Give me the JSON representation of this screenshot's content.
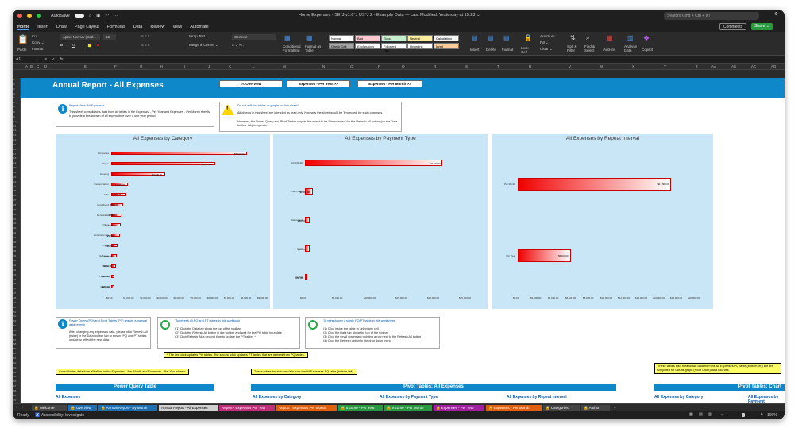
{
  "window": {
    "autosave": "AutoSave",
    "title": "Home Expenses - SE°J v1.0°J US°J 2 - Example Data — Last Modified: Yesterday at 15:23 ⌄",
    "search": "Search (Cmd + Ctrl + U)"
  },
  "menu": [
    "Home",
    "Insert",
    "Draw",
    "Page Layout",
    "Formulas",
    "Data",
    "Review",
    "View",
    "Automate"
  ],
  "menu_buttons": {
    "comments": "Comments",
    "share": "Share ⌄"
  },
  "ribbon": {
    "paste": "Paste",
    "cut": "Cut",
    "copy": "Copy ⌄",
    "format": "Format",
    "font": "Aptos Narrow (Bod...",
    "size": "12",
    "wrap": "Wrap Text ⌄",
    "merge": "Merge & Centre ⌄",
    "numfmt": "General",
    "cond": "Conditional Formatting",
    "fmt_table": "Format as Table",
    "styles": [
      {
        "label": "Normal",
        "bg": "#ffffff"
      },
      {
        "label": "Bad",
        "bg": "#ffc7ce"
      },
      {
        "label": "Good",
        "bg": "#c6efce"
      },
      {
        "label": "Neutral",
        "bg": "#ffeb9c"
      },
      {
        "label": "Calculation",
        "bg": "#f2f2f2"
      },
      {
        "label": "Check Cell",
        "bg": "#a5a5a5"
      },
      {
        "label": "Explanatory T...",
        "bg": "#ffffff"
      },
      {
        "label": "Followed Hyp...",
        "bg": "#ffffff"
      },
      {
        "label": "Hyperlink",
        "bg": "#ffffff"
      },
      {
        "label": "Input",
        "bg": "#ffcc99"
      }
    ],
    "insert": "Insert",
    "delete": "Delete",
    "format2": "Format",
    "lock": "Lock Cell",
    "autosum": "AutoSum ⌄",
    "fill": "Fill ⌄",
    "clear": "Clear ⌄",
    "sort": "Sort & Filter",
    "find": "Find & Select",
    "addins": "Add-ins",
    "analyse": "Analyse Data",
    "copilot": "Copilot"
  },
  "formula": {
    "cell": "A1",
    "fx": "fx"
  },
  "columns": [
    "A",
    "B",
    "C",
    "D",
    "E",
    "F",
    "G",
    "H",
    "I",
    "J",
    "K",
    "L",
    "M",
    "N",
    "O",
    "P",
    "Q",
    "R",
    "S",
    "T",
    "U",
    "V",
    "W",
    "X",
    "Y",
    "Z",
    "AA",
    "AB",
    "AC",
    "AD"
  ],
  "sheet": {
    "title": "Annual Report - All Expenses",
    "nav": [
      "<< Overview",
      "Expenses - Per Year >>",
      "Expenses - Per Month >>"
    ],
    "report_view_title": "Report View: All Expenses",
    "report_view_text": "This sheet consolidates data from all tables in the Expenses - Per Year and Expenses - Per Month sheets to provide a breakdown of all expenditure over a one year period.",
    "warn_title": "Do not edit the tables or graphs on this sheet!",
    "warn_text1": "All objects in this sheet are intended as read only. Normally the sheet would be 'Protected' for such purposes.",
    "warn_text2": "However, the Power Query and Pivot Tables require the sheet to be 'Unprotected' for the Refresh All button (on the Data toolbar tab) to operate.",
    "pq_title": "Power Query (PQ) and Pivot Tables (PT) require a manual data refresh",
    "pq_text": "After changing any expenses data, please click Refresh All (twice) in the Data toolbar tab to ensure PQ and PT tables update to reflect the new data.",
    "refresh_all_title": "To refresh all PQ and PT tables in this workbook",
    "refresh_all_steps": [
      "(1) Click the Data tab along the top of the toolbar",
      "(2) Click the Refresh All button in the toolbar and wait for the PQ table to update",
      "(3) Click Refresh All a second time to update the PT tables *"
    ],
    "refresh_one_title": "To refresh only a single PQ/PT table in this worksheet",
    "refresh_one_steps": [
      "(1) Click inside the table to select any cell",
      "(2) Click the Data tab along the top of the toolbar",
      "(3) Click the small downward pointing arrow next to the Refresh All button",
      "(4) Click the Refresh option in the drop down menu"
    ],
    "note_refresh": "* The first click updates PQ tables. The second click updates PT tables that are derived from PQ tables.",
    "note_consolidates": "Consolidates data from all tables in the Expenses - Per Month and Expenses - Per Year sheets.",
    "note_pivot": "These tables breakdown data from the All Expenses PQ table (bottom left).",
    "note_right": "These tables also breakdown data from the All Expenses PQ table (bottom left) but are simplified for use as graph (Pivot Chart) data sources.",
    "pq_section": "Power Query Table",
    "pivot_section": "Pivot Tables: All Expenses",
    "pivot_section2": "Pivot Tables: Chart",
    "links": [
      "All Expenses",
      "All Expenses by Category",
      "All Expenses by Payment Type",
      "All Expenses by Repeat Interval",
      "All Expenses by Category",
      "All Expenses by Payment"
    ]
  },
  "chart_data": [
    {
      "type": "bar",
      "title": "All Expenses by Category",
      "categories": [
        "Groceries",
        "Taxes",
        "Housing",
        "Transportation",
        "Gifts",
        "Broadband",
        "Renewable",
        "Other",
        "Entertainment",
        "Food",
        "Software",
        "Online",
        "Personal",
        "Savings"
      ],
      "values": [
        8100,
        6200,
        3200,
        1000,
        900,
        700,
        600,
        580,
        500,
        400,
        350,
        300,
        200,
        200
      ],
      "value_labels": [
        "$8,100.00",
        "$6,200.00",
        "$3,200.00",
        "$1,000.00",
        "$900.00",
        "$700.00",
        "$600.00",
        "$580.00",
        "$500.00",
        "$400.00",
        "$350.00",
        "$300.00",
        "$200.00",
        "$200.00"
      ],
      "xticks": [
        "$0.00",
        "$1,000.00",
        "$2,000.00",
        "$3,000.00",
        "$4,000.00",
        "$5,000.00",
        "$6,000.00",
        "$7,000.00",
        "$8,000.00",
        "$9,000.00"
      ],
      "xlim": [
        0,
        9000
      ]
    },
    {
      "type": "bar",
      "title": "All Expenses by Payment Type",
      "categories": [
        "ACH/Debit",
        "Credit Card",
        "Debit Card",
        "Cash",
        "PayPal"
      ],
      "values": [
        21600,
        1200,
        800,
        800,
        300
      ],
      "value_labels": [
        "$21,600.00",
        "$1,200.00",
        "$800.00",
        "$800.00",
        "$300.00"
      ],
      "xticks": [
        "$0.00",
        "$5,000.00",
        "$10,000.00",
        "$15,000.00",
        "$20,000.00",
        "$25,000.00"
      ],
      "xlim": [
        0,
        25000
      ]
    },
    {
      "type": "bar",
      "title": "All Expenses by Repeat Interval",
      "categories": [
        "Per Month",
        "Per Year"
      ],
      "values": [
        17500,
        6100
      ],
      "value_labels": [
        "$17,500.00",
        "$6,100.00"
      ],
      "xticks": [
        "$0.00",
        "$2,000.00",
        "$4,000.00",
        "$6,000.00",
        "$8,000.00",
        "$10,000.00",
        "$12,000.00",
        "$14,000.00",
        "$16,000.00",
        "$18,000.00",
        "$20,000.00"
      ],
      "xlim": [
        0,
        20000
      ]
    }
  ],
  "tabs": [
    {
      "label": "🔒 Welcome",
      "bg": "#444444"
    },
    {
      "label": "🔒 Overview",
      "bg": "#1f6fb0"
    },
    {
      "label": "🔒 Annual Report - By Month",
      "bg": "#1f6fb0"
    },
    {
      "label": "Annual Report - All Expenses",
      "bg": "#d0d0d0"
    },
    {
      "label": "Report - Expenses Per Year",
      "bg": "#c0307a"
    },
    {
      "label": "Report - Expenses Per Month",
      "bg": "#e06010"
    },
    {
      "label": "🔒 Income - Per Year",
      "bg": "#2a9a40"
    },
    {
      "label": "🔒 Income - Per Month",
      "bg": "#2a9a40"
    },
    {
      "label": "🔒 Expenses - Per Year",
      "bg": "#a020a0"
    },
    {
      "label": "🔒 Expenses - Per Month",
      "bg": "#e06010"
    },
    {
      "label": "🔒 Categories",
      "bg": "#444444"
    },
    {
      "label": "🔒 Author",
      "bg": "#444444"
    },
    {
      "label": "+",
      "bg": "#2b2b2b"
    }
  ],
  "status": {
    "ready": "Ready",
    "access": "Accessibility: Investigate",
    "zoom": "100%"
  }
}
